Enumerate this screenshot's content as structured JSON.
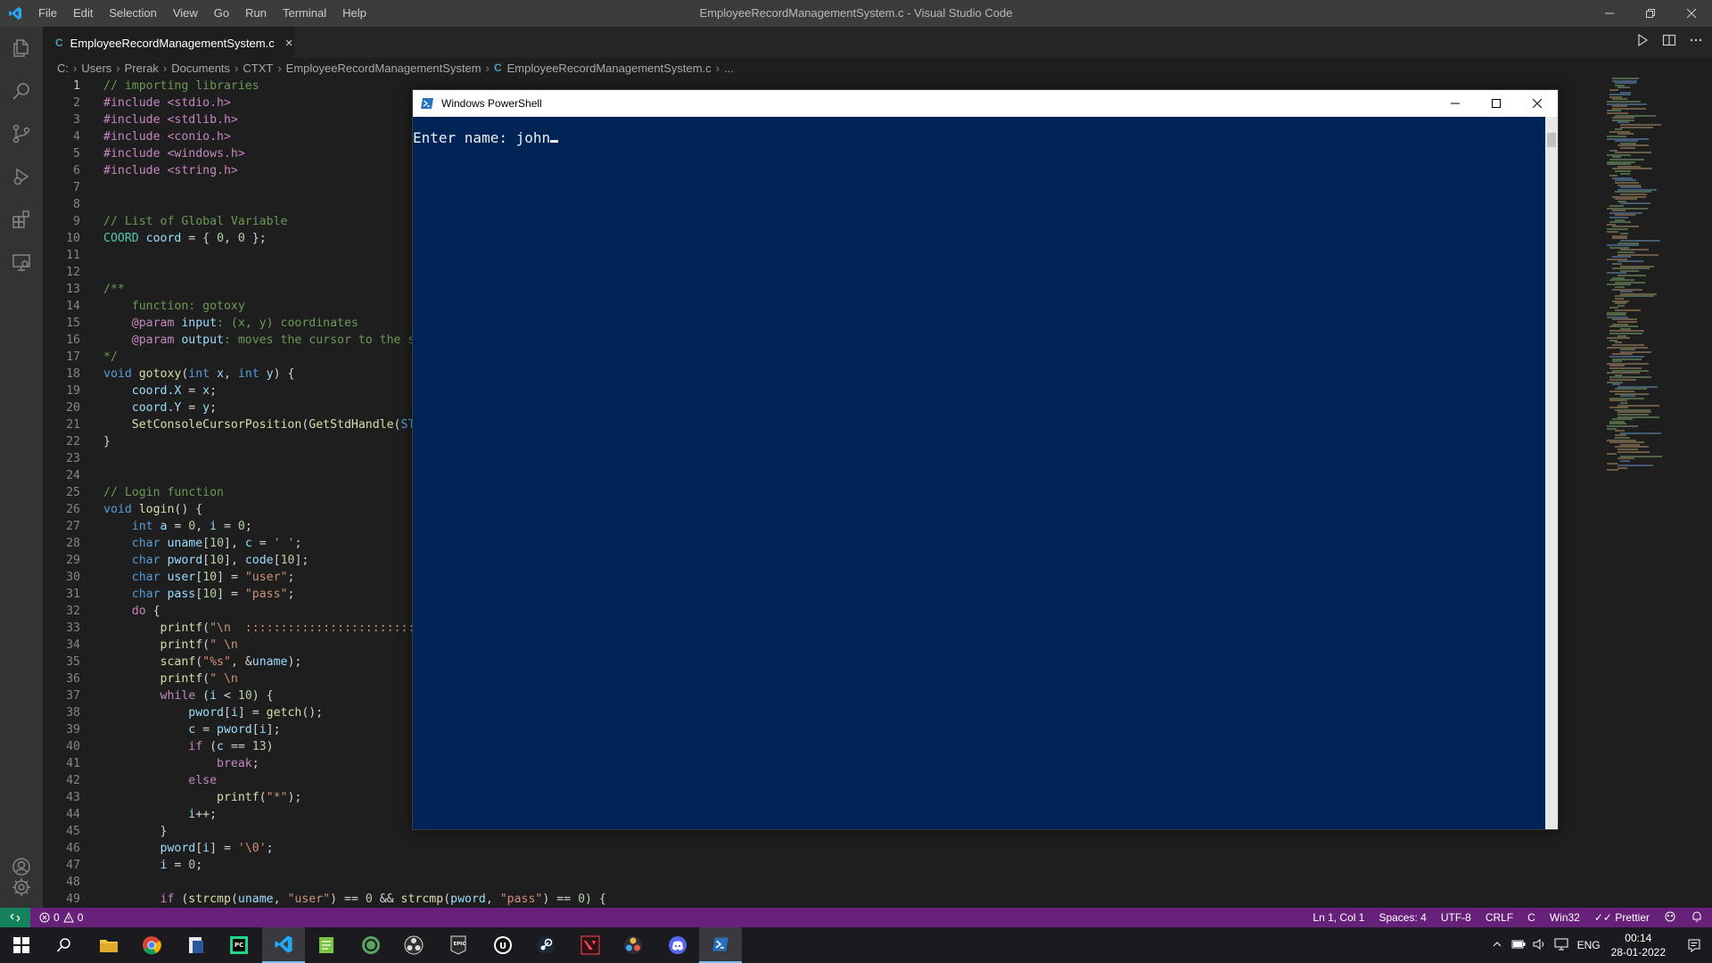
{
  "window": {
    "title": "EmployeeRecordManagementSystem.c - Visual Studio Code",
    "menu": [
      "File",
      "Edit",
      "Selection",
      "View",
      "Go",
      "Run",
      "Terminal",
      "Help"
    ]
  },
  "tab": {
    "label": "EmployeeRecordManagementSystem.c",
    "icon": "C"
  },
  "breadcrumbs": {
    "items": [
      "C:",
      "Users",
      "Prerak",
      "Documents",
      "CTXT",
      "EmployeeRecordManagementSystem"
    ],
    "file_icon": "C",
    "file": "EmployeeRecordManagementSystem.c",
    "ellipsis": "..."
  },
  "editor": {
    "lines": [
      {
        "n": "1"
      },
      {
        "n": "2"
      },
      {
        "n": "3"
      },
      {
        "n": "4"
      },
      {
        "n": "5"
      },
      {
        "n": "6"
      },
      {
        "n": "7"
      },
      {
        "n": "8"
      },
      {
        "n": "9"
      },
      {
        "n": "10"
      },
      {
        "n": "11"
      },
      {
        "n": "12"
      },
      {
        "n": "13"
      },
      {
        "n": "14"
      },
      {
        "n": "15"
      },
      {
        "n": "16"
      },
      {
        "n": "17"
      },
      {
        "n": "18"
      },
      {
        "n": "19"
      },
      {
        "n": "20"
      },
      {
        "n": "21"
      },
      {
        "n": "22"
      },
      {
        "n": "23"
      },
      {
        "n": "24"
      },
      {
        "n": "25"
      },
      {
        "n": "26"
      },
      {
        "n": "27"
      },
      {
        "n": "28"
      },
      {
        "n": "29"
      },
      {
        "n": "30"
      },
      {
        "n": "31"
      },
      {
        "n": "32"
      },
      {
        "n": "33"
      },
      {
        "n": "34"
      },
      {
        "n": "35"
      },
      {
        "n": "36"
      },
      {
        "n": "37"
      },
      {
        "n": "38"
      },
      {
        "n": "39"
      },
      {
        "n": "40"
      },
      {
        "n": "41"
      },
      {
        "n": "42"
      },
      {
        "n": "43"
      },
      {
        "n": "44"
      },
      {
        "n": "45"
      },
      {
        "n": "46"
      },
      {
        "n": "47"
      },
      {
        "n": "48"
      },
      {
        "n": "49"
      }
    ],
    "code": {
      "l1": "// importing libraries",
      "l2": "#include <stdio.h>",
      "l3": "#include <stdlib.h>",
      "l4": "#include <conio.h>",
      "l5": "#include <windows.h>",
      "l6": "#include <string.h>",
      "l9": "// List of Global Variable",
      "l10_type": "COORD",
      "l10_var": "coord",
      "l10_rest": " = { ",
      "l10_n1": "0",
      "l10_sep": ", ",
      "l10_n2": "0",
      "l10_end": " };",
      "l13": "/**",
      "l14": "    function: gotoxy",
      "l15_tag": "    @param",
      "l15_name": " input",
      "l15_rest": ": (x, y) coordinates",
      "l16_tag": "    @param",
      "l16_name": " output",
      "l16_rest": ": moves the cursor to the sp",
      "l17": "*/",
      "l18_kw": "void",
      "l18_fn": " gotoxy",
      "l18_p1": "(",
      "l18_k1": "int",
      "l18_v1": " x",
      "l18_p2": ", ",
      "l18_k2": "int",
      "l18_v2": " y",
      "l18_p3": ") {",
      "l19_var": "    coord.X",
      "l19_rest": " = ",
      "l19_v": "x",
      "l19_end": ";",
      "l20_var": "    coord.Y",
      "l20_rest": " = ",
      "l20_v": "y",
      "l20_end": ";",
      "l21_fn": "    SetConsoleCursorPosition",
      "l21_p": "(",
      "l21_fn2": "GetStdHandle",
      "l21_p2": "(",
      "l21_c": "STD",
      "l22": "}",
      "l25": "// Login function",
      "l26_kw": "void",
      "l26_fn": " login",
      "l26_rest": "() {",
      "l27_kw": "    int",
      "l27_v1": " a",
      "l27_r1": " = ",
      "l27_n1": "0",
      "l27_r2": ", ",
      "l27_v2": "i",
      "l27_r3": " = ",
      "l27_n2": "0",
      "l27_end": ";",
      "l28_kw": "    char",
      "l28_v1": " uname",
      "l28_r1": "[",
      "l28_n": "10",
      "l28_r2": "], ",
      "l28_v2": "c",
      "l28_r3": " = ",
      "l28_s": "' '",
      "l28_end": ";",
      "l29_kw": "    char",
      "l29_v1": " pword",
      "l29_r1": "[",
      "l29_n1": "10",
      "l29_r2": "], ",
      "l29_v2": "code",
      "l29_r3": "[",
      "l29_n2": "10",
      "l29_end": "];",
      "l30_kw": "    char",
      "l30_v": " user",
      "l30_r1": "[",
      "l30_n": "10",
      "l30_r2": "] = ",
      "l30_s": "\"user\"",
      "l30_end": ";",
      "l31_kw": "    char",
      "l31_v": " pass",
      "l31_r1": "[",
      "l31_n": "10",
      "l31_r2": "] = ",
      "l31_s": "\"pass\"",
      "l31_end": ";",
      "l32_kw": "    do",
      "l32_rest": " {",
      "l33_fn": "        printf",
      "l33_p": "(",
      "l33_s": "\"\\n  ::::::::::::::::::::::::::",
      "l34_fn": "        printf",
      "l34_p": "(",
      "l34_s": "\" \\n                          ENT",
      "l35_fn": "        scanf",
      "l35_p": "(",
      "l35_s": "\"%s\"",
      "l35_r": ", &",
      "l35_v": "uname",
      "l35_end": ");",
      "l36_fn": "        printf",
      "l36_p": "(",
      "l36_s": "\" \\n                          ENT",
      "l37_kw": "        while",
      "l37_r1": " (",
      "l37_v": "i",
      "l37_r2": " < ",
      "l37_n": "10",
      "l37_end": ") {",
      "l38_v": "            pword",
      "l38_r1": "[",
      "l38_v2": "i",
      "l38_r2": "] = ",
      "l38_fn": "getch",
      "l38_end": "();",
      "l39_v": "            c",
      "l39_r1": " = ",
      "l39_v2": "pword",
      "l39_r2": "[",
      "l39_v3": "i",
      "l39_end": "];",
      "l40_kw": "            if",
      "l40_r1": " (",
      "l40_v": "c",
      "l40_r2": " == ",
      "l40_n": "13",
      "l40_end": ")",
      "l41_kw": "                break",
      "l41_end": ";",
      "l42_kw": "            else",
      "l43_fn": "                printf",
      "l43_p": "(",
      "l43_s": "\"*\"",
      "l43_end": ");",
      "l44_v": "            i",
      "l44_end": "++;",
      "l45": "        }",
      "l46_v": "        pword",
      "l46_r1": "[",
      "l46_v2": "i",
      "l46_r2": "] = ",
      "l46_s": "'\\0'",
      "l46_end": ";",
      "l47_v": "        i",
      "l47_r1": " = ",
      "l47_n": "0",
      "l47_end": ";",
      "l49_kw": "        if",
      "l49_r1": " (",
      "l49_fn": "strcmp",
      "l49_r2": "(",
      "l49_v": "uname",
      "l49_r3": ", ",
      "l49_s": "\"user\"",
      "l49_r4": ") == ",
      "l49_n": "0",
      "l49_r5": " && ",
      "l49_fn2": "strcmp",
      "l49_r6": "(",
      "l49_v2": "pword",
      "l49_r7": ", ",
      "l49_s2": "\"pass\"",
      "l49_r8": ") == ",
      "l49_n2": "0",
      "l49_end": ") {"
    }
  },
  "powershell": {
    "title": "Windows PowerShell",
    "prompt": "Enter name: ",
    "input": "john"
  },
  "statusbar": {
    "errors": "0",
    "warnings": "0",
    "position": "Ln 1, Col 1",
    "spaces": "Spaces: 4",
    "encoding": "UTF-8",
    "eol": "CRLF",
    "language": "C",
    "platform": "Win32",
    "prettier": "Prettier"
  },
  "taskbar": {
    "language": "ENG",
    "time": "00:14",
    "date": "28-01-2022"
  },
  "colors": {
    "accent": "#007acc",
    "statusbar": "#68217a",
    "powershell_bg": "#012456"
  }
}
